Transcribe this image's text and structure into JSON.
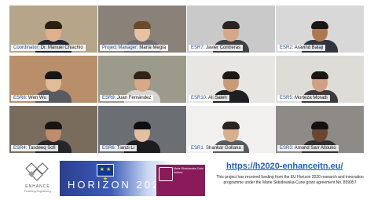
{
  "participants": [
    {
      "role": "Coordinator: ",
      "name": "Dr. Manuel Chiachio",
      "bg": "#b7a58a",
      "skin": "#e0b08d",
      "hair": "#2b1e15",
      "shirt": "#1f2630"
    },
    {
      "role": "Project Manager: ",
      "name": "María Megía",
      "bg": "#8a8279",
      "skin": "#e6c2a1",
      "hair": "#6a4a2a",
      "shirt": "#6d6e72"
    },
    {
      "role": "ESR7: ",
      "name": "Javier Contreras",
      "bg": "#c9c9c9",
      "skin": "#d6a785",
      "hair": "#2a2320",
      "shirt": "#3c3f45"
    },
    {
      "role": "ESR2: ",
      "name": "Aravind Balaji",
      "bg": "#d8d8d8",
      "skin": "#b07850",
      "hair": "#1a1412",
      "shirt": "#2f3440"
    },
    {
      "role": "ESR8: ",
      "name": "Wen Wu",
      "bg": "#b88f6a",
      "skin": "#e0bd9a",
      "hair": "#151515",
      "shirt": "#585a60"
    },
    {
      "role": "ESR9: ",
      "name": "Juan Fernández",
      "bg": "#9c9a8a",
      "skin": "#d7a989",
      "hair": "#2e2319",
      "shirt": "#d8d5d0"
    },
    {
      "role": "ESR10: ",
      "name": "Ali Saleh",
      "bg": "#e8e6e2",
      "skin": "#c89b78",
      "hair": "#1c1814",
      "shirt": "#1d1f24"
    },
    {
      "role": "ESR5: ",
      "name": "Morteza Moradi",
      "bg": "#dedcd6",
      "skin": "#cfa083",
      "hair": "#1a1614",
      "shirt": "#3a3a3e"
    },
    {
      "role": "ESR4: ",
      "name": "Tasdeeq Sofi",
      "bg": "#7a6c5c",
      "skin": "#c08c6c",
      "hair": "#181411",
      "shirt": "#24262c"
    },
    {
      "role": "ESR6: ",
      "name": "Tianzi Li",
      "bg": "#6b6e72",
      "skin": "#e3c0a0",
      "hair": "#0f0f10",
      "shirt": "#1c1c1f"
    },
    {
      "role": "ESR1: ",
      "name": "Shankar Gollana",
      "bg": "#f1f0ee",
      "skin": "#d8ae8d",
      "hair": "#2a2420",
      "shirt": "#555a62"
    },
    {
      "role": "ESR3: ",
      "name": "Amond Sarr Allouko",
      "bg": "#8e8a86",
      "skin": "#6b4630",
      "hair": "#111111",
      "shirt": "#2d2f33"
    }
  ],
  "footer": {
    "logo_text": "ENHANCE",
    "logo_sub": "Featuring Engineering",
    "program_label": "HORIZON 2020",
    "msca_label": "Marie Skłodowska-Curie Actions",
    "url": "https://h2020-enhanceitn.eu/",
    "funding_text": "This project has received funding from the EU Horizon 2020 research and innovation programme under the Marie Skłodowska-Curie grant agreement No. 859957"
  }
}
